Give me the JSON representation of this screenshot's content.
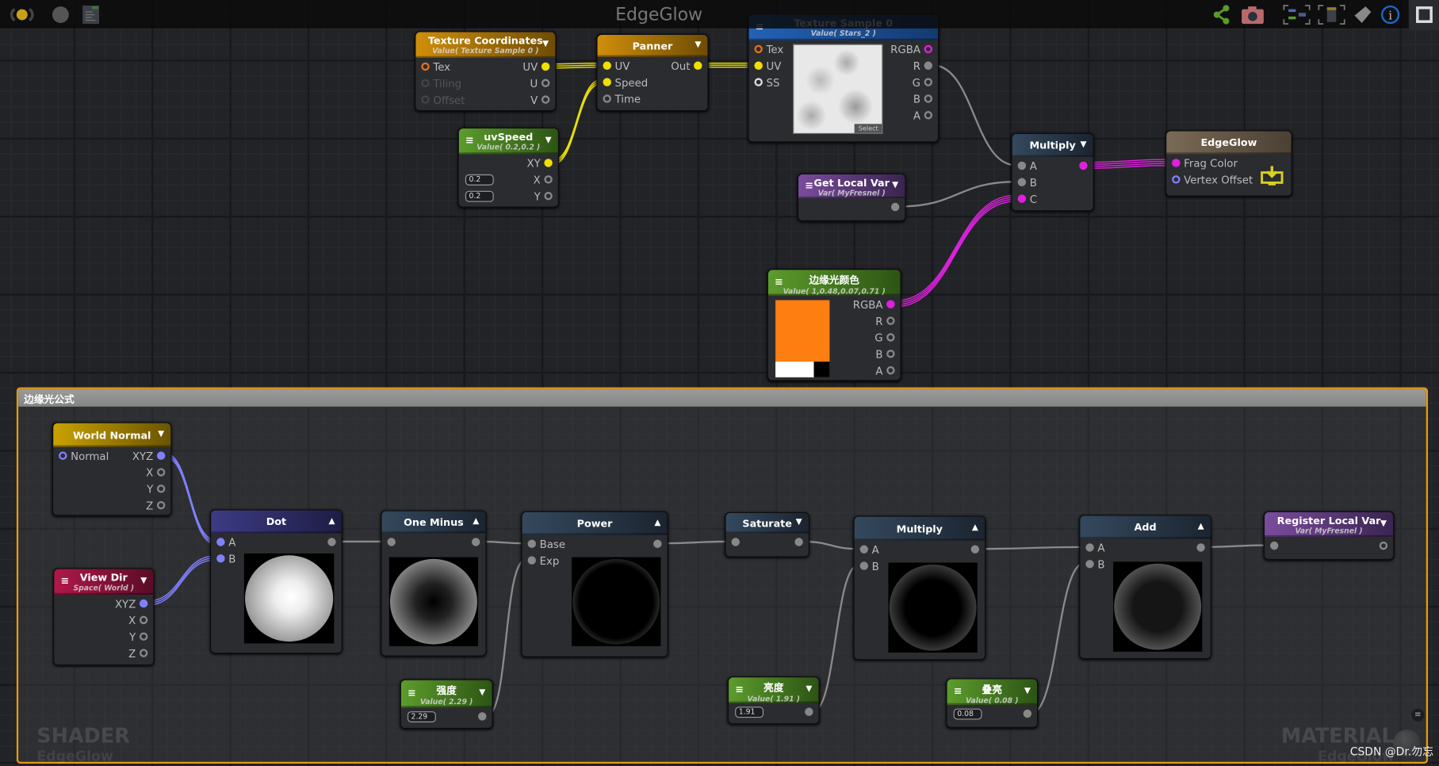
{
  "window": {
    "title": "EdgeGlow",
    "watermark_left": "SHADER",
    "watermark_left_sub": "EdgeGlow",
    "watermark_right": "MATERIAL",
    "watermark_right_sub": "EdgeGlow",
    "credit": "CSDN @Dr.勿忘"
  },
  "toolbar": {
    "left_icons": [
      "live-update-icon",
      "preview-sphere-icon",
      "shader-code-icon"
    ],
    "right_icons": [
      "share-icon",
      "camera-icon",
      "focus-graph-icon",
      "focus-node-icon",
      "clean-icon",
      "info-icon",
      "maximize-icon"
    ]
  },
  "group": {
    "title": "边缘光公式",
    "accent": "#e59a10"
  },
  "nodes": {
    "texcoord": {
      "title": "Texture Coordinates",
      "subtitle": "Value( Texture Sample 0 )",
      "arrow": "▼",
      "inputs": [
        {
          "label": "Tex",
          "c": "#e07020",
          "f": 0
        },
        {
          "label": "Tiling",
          "c": "#444",
          "f": 0,
          "dim": 1
        },
        {
          "label": "Offset",
          "c": "#444",
          "f": 0,
          "dim": 1
        }
      ],
      "outputs": [
        {
          "label": "UV",
          "c": "#f0e000",
          "f": 1
        },
        {
          "label": "U",
          "c": "#888",
          "f": 0
        },
        {
          "label": "V",
          "c": "#888",
          "f": 0
        }
      ]
    },
    "panner": {
      "title": "Panner",
      "arrow": "▼",
      "inputs": [
        {
          "label": "UV",
          "c": "#f0e000",
          "f": 1
        },
        {
          "label": "Speed",
          "c": "#f0e000",
          "f": 1
        },
        {
          "label": "Time",
          "c": "#888",
          "f": 0
        }
      ],
      "outputs": [
        {
          "label": "Out",
          "c": "#f0e000",
          "f": 1
        }
      ]
    },
    "texsample": {
      "title": "Texture Sample 0",
      "subtitle": "Value( Stars_2 )",
      "menu": "≡",
      "select_label": "Select",
      "inputs": [
        {
          "label": "Tex",
          "c": "#e07020",
          "f": 0
        },
        {
          "label": "UV",
          "c": "#f0e000",
          "f": 1
        },
        {
          "label": "SS",
          "c": "#ddd",
          "f": 0
        }
      ],
      "outputs": [
        {
          "label": "RGBA",
          "c": "#e020e0",
          "f": 0
        },
        {
          "label": "R",
          "c": "#888",
          "f": 1
        },
        {
          "label": "G",
          "c": "#888",
          "f": 0
        },
        {
          "label": "B",
          "c": "#888",
          "f": 0
        },
        {
          "label": "A",
          "c": "#888",
          "f": 0
        }
      ]
    },
    "uvspeed": {
      "title": "uvSpeed",
      "subtitle": "Value( 0.2,0.2 )",
      "menu": "≡",
      "arrow": "▼",
      "inputs": [
        {
          "label": "",
          "field": ""
        },
        {
          "label": "",
          "field": "0.2"
        },
        {
          "label": "",
          "field": "0.2"
        }
      ],
      "outputs": [
        {
          "label": "XY",
          "c": "#f0e000",
          "f": 1
        },
        {
          "label": "X",
          "c": "#888",
          "f": 0
        },
        {
          "label": "Y",
          "c": "#888",
          "f": 0
        }
      ]
    },
    "multiply1": {
      "title": "Multiply",
      "arrow": "▼",
      "inputs": [
        {
          "label": "A",
          "c": "#888",
          "f": 1
        },
        {
          "label": "B",
          "c": "#888",
          "f": 1
        },
        {
          "label": "C",
          "c": "#e020e0",
          "f": 1
        }
      ],
      "outputs": [
        {
          "label": "",
          "c": "#e020e0",
          "f": 1
        }
      ]
    },
    "output": {
      "title": "EdgeGlow",
      "inputs": [
        {
          "label": "Frag Color",
          "c": "#e020e0",
          "f": 1
        },
        {
          "label": "Vertex Offset",
          "c": "#8080ff",
          "f": 0
        }
      ],
      "outputs": []
    },
    "getlocal": {
      "title": "Get Local Var",
      "subtitle": "Var( MyFresnel )",
      "menu": "≡",
      "arrow": "▼",
      "inputs": [],
      "outputs": [
        {
          "label": "",
          "c": "#888",
          "f": 1
        }
      ]
    },
    "color": {
      "title": "边缘光颜色",
      "subtitle": "Value( 1,0.48,0.07,0.71 )",
      "menu": "≡",
      "swatch": "#ff7e12",
      "inputs": [],
      "outputs": [
        {
          "label": "RGBA",
          "c": "#e020e0",
          "f": 1
        },
        {
          "label": "R",
          "c": "#888",
          "f": 0
        },
        {
          "label": "G",
          "c": "#888",
          "f": 0
        },
        {
          "label": "B",
          "c": "#888",
          "f": 0
        },
        {
          "label": "A",
          "c": "#888",
          "f": 0
        }
      ]
    },
    "worldnormal": {
      "title": "World Normal",
      "arrow": "▼",
      "inputs": [
        {
          "label": "Normal",
          "c": "#8080ff",
          "f": 0
        }
      ],
      "outputs": [
        {
          "label": "XYZ",
          "c": "#8080ff",
          "f": 1
        },
        {
          "label": "X",
          "c": "#888",
          "f": 0
        },
        {
          "label": "Y",
          "c": "#888",
          "f": 0
        },
        {
          "label": "Z",
          "c": "#888",
          "f": 0
        }
      ]
    },
    "viewdir": {
      "title": "View Dir",
      "subtitle": "Space( World )",
      "menu": "≡",
      "arrow": "▼",
      "inputs": [],
      "outputs": [
        {
          "label": "XYZ",
          "c": "#8080ff",
          "f": 1
        },
        {
          "label": "X",
          "c": "#888",
          "f": 0
        },
        {
          "label": "Y",
          "c": "#888",
          "f": 0
        },
        {
          "label": "Z",
          "c": "#888",
          "f": 0
        }
      ]
    },
    "dot": {
      "title": "Dot",
      "arrow": "▲",
      "preview": "dot",
      "inputs": [
        {
          "label": "A",
          "c": "#8080ff",
          "f": 1
        },
        {
          "label": "B",
          "c": "#8080ff",
          "f": 1
        }
      ],
      "outputs": [
        {
          "label": "",
          "c": "#888",
          "f": 1
        }
      ]
    },
    "oneminus": {
      "title": "One Minus",
      "arrow": "▲",
      "preview": "oneminus",
      "inputs": [
        {
          "label": "",
          "c": "#888",
          "f": 1
        }
      ],
      "outputs": [
        {
          "label": "",
          "c": "#888",
          "f": 1
        }
      ]
    },
    "power": {
      "title": "Power",
      "arrow": "▲",
      "preview": "power",
      "inputs": [
        {
          "label": "Base",
          "c": "#888",
          "f": 1
        },
        {
          "label": "Exp",
          "c": "#888",
          "f": 1
        }
      ],
      "outputs": [
        {
          "label": "",
          "c": "#888",
          "f": 1
        }
      ]
    },
    "saturate": {
      "title": "Saturate",
      "arrow": "▼",
      "inputs": [
        {
          "label": "",
          "c": "#888",
          "f": 1
        }
      ],
      "outputs": [
        {
          "label": "",
          "c": "#888",
          "f": 1
        }
      ]
    },
    "multiply2": {
      "title": "Multiply",
      "arrow": "▲",
      "preview": "rim",
      "inputs": [
        {
          "label": "A",
          "c": "#888",
          "f": 1
        },
        {
          "label": "B",
          "c": "#888",
          "f": 1
        }
      ],
      "outputs": [
        {
          "label": "",
          "c": "#888",
          "f": 1
        }
      ]
    },
    "add": {
      "title": "Add",
      "arrow": "▲",
      "preview": "add",
      "inputs": [
        {
          "label": "A",
          "c": "#888",
          "f": 1
        },
        {
          "label": "B",
          "c": "#888",
          "f": 1
        }
      ],
      "outputs": [
        {
          "label": "",
          "c": "#888",
          "f": 1
        }
      ]
    },
    "register": {
      "title": "Register Local Var",
      "subtitle": "Var( MyFresnel )",
      "arrow": "▼",
      "inputs": [
        {
          "label": "",
          "c": "#888",
          "f": 1
        }
      ],
      "outputs": [
        {
          "label": "",
          "c": "#888",
          "f": 0
        }
      ]
    },
    "intensity": {
      "title": "强度",
      "subtitle": "Value( 2.29 )",
      "menu": "≡",
      "arrow": "▼",
      "inputs": [
        {
          "label": "",
          "field": "2.29"
        }
      ],
      "outputs": [
        {
          "label": "",
          "c": "#888",
          "f": 1
        }
      ]
    },
    "brightness": {
      "title": "亮度",
      "subtitle": "Value( 1.91 )",
      "menu": "≡",
      "arrow": "▼",
      "inputs": [
        {
          "label": "",
          "field": "1.91"
        }
      ],
      "outputs": [
        {
          "label": "",
          "c": "#888",
          "f": 1
        }
      ]
    },
    "overlay": {
      "title": "叠亮",
      "subtitle": "Value( 0.08 )",
      "menu": "≡",
      "arrow": "▼",
      "inputs": [
        {
          "label": "",
          "field": "0.08"
        }
      ],
      "outputs": [
        {
          "label": "",
          "c": "#888",
          "f": 1
        }
      ]
    }
  }
}
